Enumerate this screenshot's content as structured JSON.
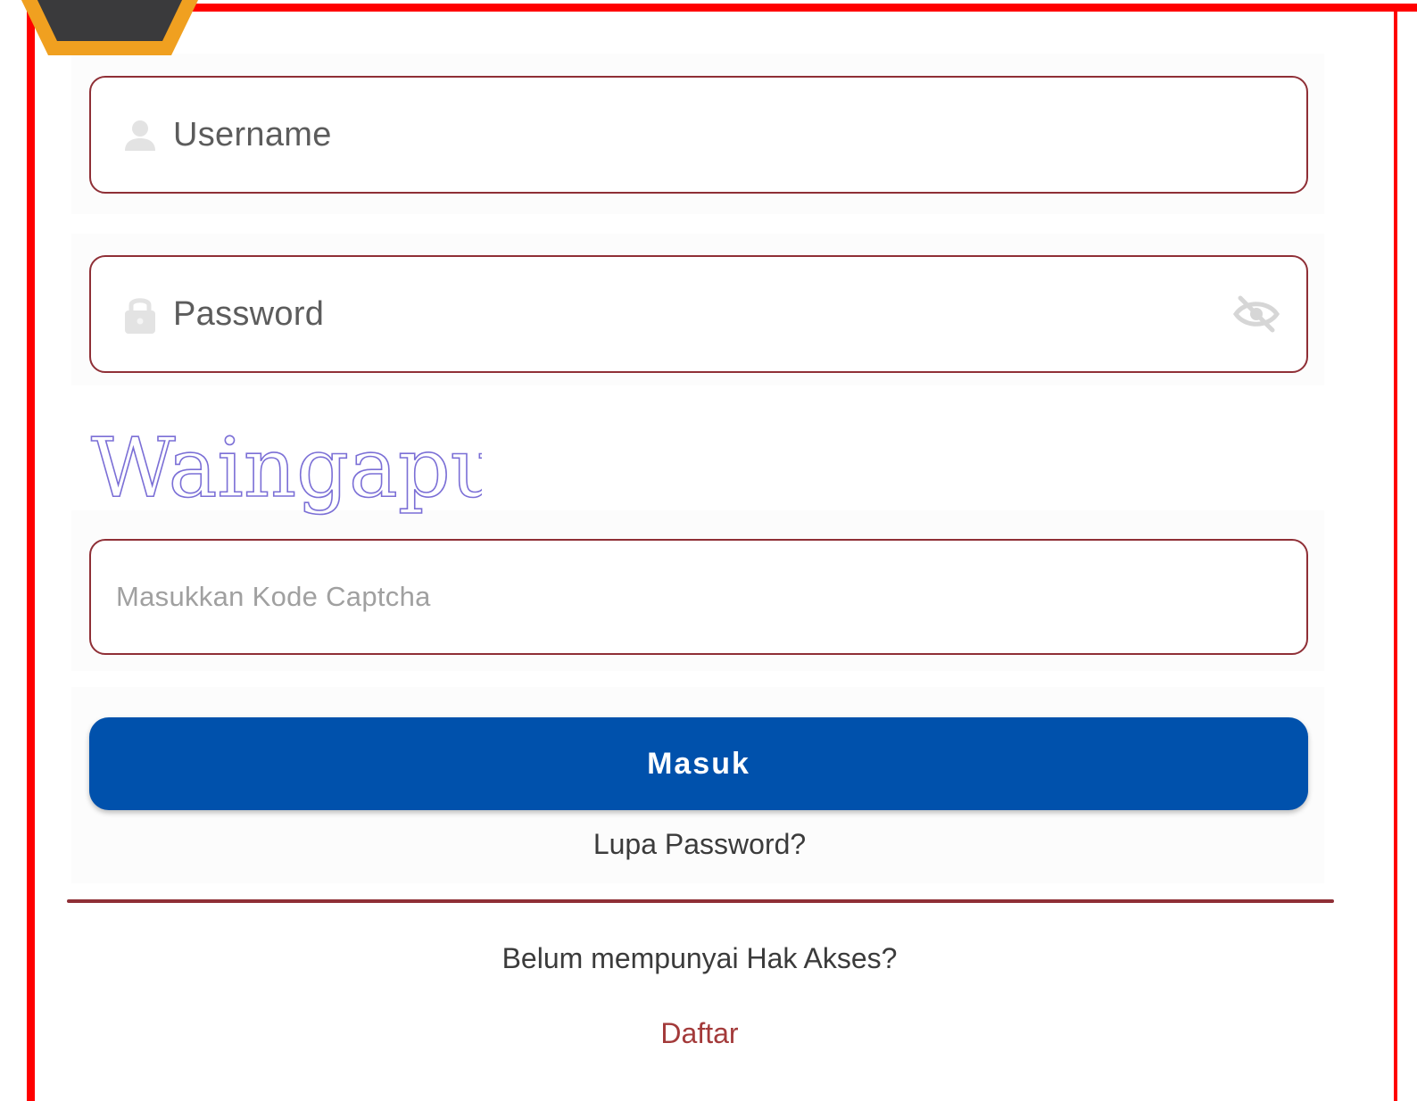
{
  "login_form": {
    "username": {
      "placeholder": "Username",
      "icon": "user-icon"
    },
    "password": {
      "placeholder": "Password",
      "icon": "lock-icon",
      "toggle_icon": "eye-slash-icon"
    },
    "captcha": {
      "image_text": "Waingapu",
      "placeholder": "Masukkan Kode Captcha"
    },
    "submit_label": "Masuk",
    "forgot_label": "Lupa Password?",
    "no_access_text": "Belum mempunyai Hak Akses?",
    "register_label": "Daftar"
  },
  "colors": {
    "highlight_frame": "#ff0000",
    "badge_fill": "#3a3a3c",
    "badge_border": "#f0a020",
    "field_border": "#8f2f36",
    "button_bg": "#0051ac",
    "register_link": "#a33a3a",
    "captcha_text": "#7b6fd6"
  }
}
